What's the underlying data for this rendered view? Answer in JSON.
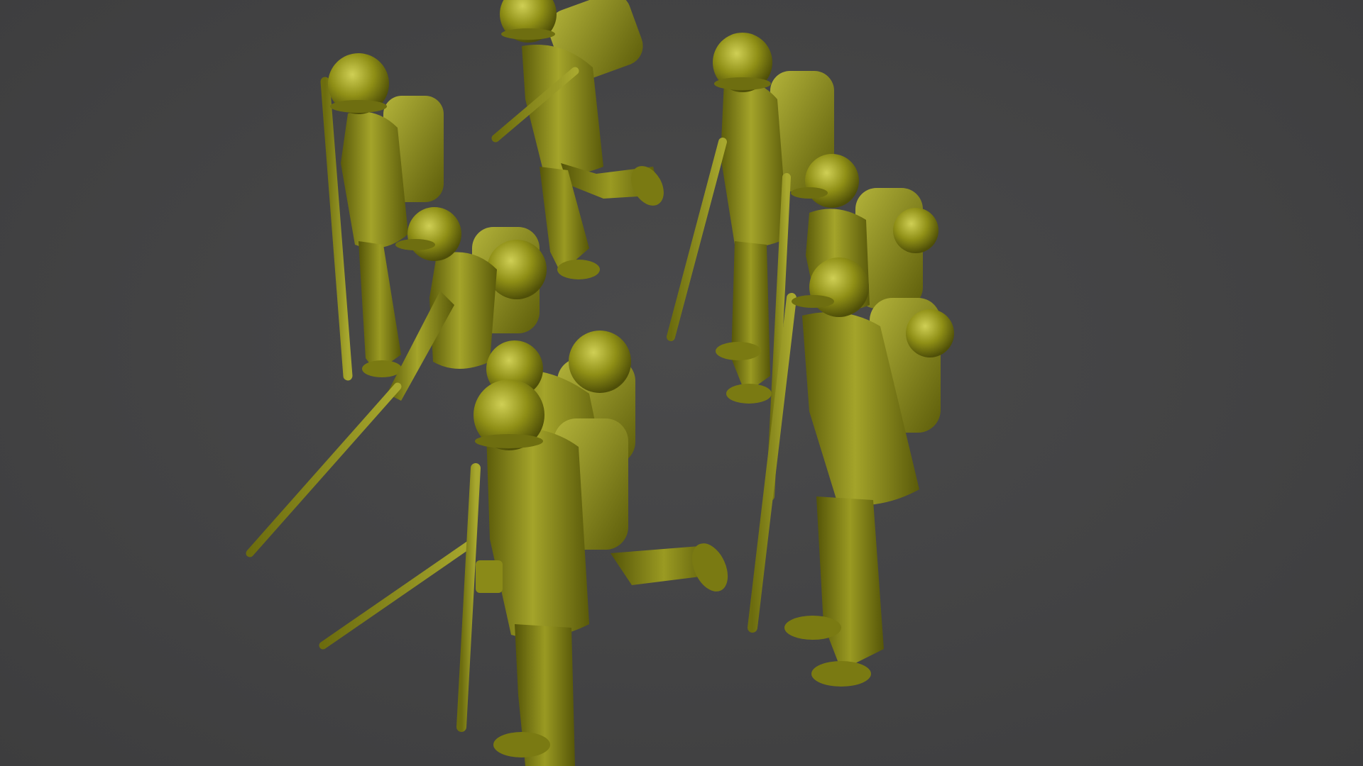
{
  "scene": {
    "background_color": "#434344",
    "model_color": "#8a8a14",
    "model_highlight": "#c9c94a",
    "model_shadow": "#4d4d08",
    "figure_count": 8,
    "figures": [
      {
        "pose": "standing-rifle-at-side",
        "helmet": "round-helmet",
        "gear": "backpack"
      },
      {
        "pose": "running-leap",
        "helmet": "round-helmet",
        "gear": "backpack"
      },
      {
        "pose": "standing-rifle-forward",
        "helmet": "round-helmet",
        "gear": "backpack"
      },
      {
        "pose": "standing-at-attention",
        "helmet": "field-cap",
        "gear": "backpack-with-helmet"
      },
      {
        "pose": "standing-at-attention",
        "helmet": "field-cap",
        "gear": "backpack-with-helmet"
      },
      {
        "pose": "crouching-bayonet-thrust",
        "helmet": "field-cap",
        "gear": "backpack-with-helmet"
      },
      {
        "pose": "running-with-bayonet",
        "helmet": "round-helmet",
        "gear": "backpack"
      },
      {
        "pose": "walking-rifle-slung",
        "helmet": "round-helmet",
        "gear": "backpack"
      }
    ]
  }
}
